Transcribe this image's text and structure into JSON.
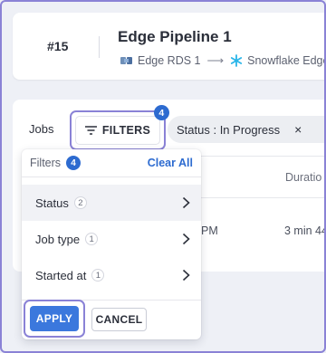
{
  "pipeline": {
    "number": "#15",
    "title": "Edge Pipeline 1",
    "source": "Edge RDS 1",
    "destination": "Snowflake Edge"
  },
  "jobs": {
    "label": "Jobs",
    "filters_button": "FILTERS",
    "filters_count": "4",
    "status_chip": "Status : In Progress",
    "status_chip_close": "×",
    "column_duration": "Duratio",
    "column_partial": "",
    "row_time_partial": "PM",
    "row_duration_partial": "3 min 44"
  },
  "filters_panel": {
    "title": "Filters",
    "count": "4",
    "clear_all": "Clear All",
    "items": [
      {
        "label": "Status",
        "count": "2"
      },
      {
        "label": "Job type",
        "count": "1"
      },
      {
        "label": "Started at",
        "count": "1"
      }
    ],
    "apply_label": "APPLY",
    "cancel_label": "CANCEL"
  },
  "colors": {
    "accent": "#2d6bd0",
    "highlight_outline": "#8a82d6",
    "background": "#eef0f6"
  }
}
